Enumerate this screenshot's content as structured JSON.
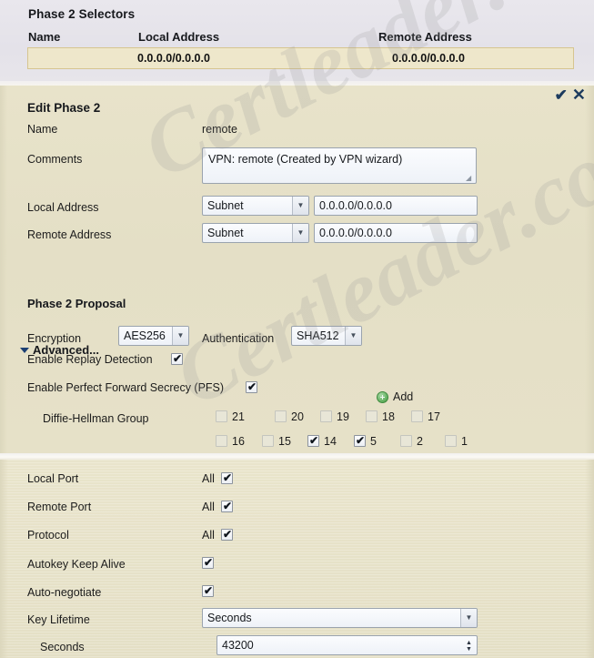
{
  "selectors": {
    "title": "Phase 2 Selectors",
    "columns": [
      "Name",
      "Local Address",
      "Remote Address"
    ],
    "rows": [
      {
        "name": "",
        "local_address": "0.0.0.0/0.0.0.0",
        "remote_address": "0.0.0.0/0.0.0.0"
      }
    ]
  },
  "dialog": {
    "title": "Edit Phase 2",
    "ok_icon": "✔",
    "cancel_icon": "✕",
    "fields": {
      "name_label": "Name",
      "name_value": "remote",
      "comments_label": "Comments",
      "comments_value": "VPN: remote (Created by VPN wizard)",
      "local_address_label": "Local Address",
      "local_address_type": "Subnet",
      "local_address_value": "0.0.0.0/0.0.0.0",
      "remote_address_label": "Remote Address",
      "remote_address_type": "Subnet",
      "remote_address_value": "0.0.0.0/0.0.0.0"
    },
    "advanced_label": "Advanced..."
  },
  "proposal": {
    "title": "Phase 2 Proposal",
    "add_label": "Add",
    "encryption_label": "Encryption",
    "encryption_value": "AES256",
    "authentication_label": "Authentication",
    "authentication_value": "SHA512",
    "replay_label": "Enable Replay Detection",
    "replay_checked": true,
    "pfs_label": "Enable Perfect Forward Secrecy (PFS)",
    "pfs_checked": true,
    "dh_label": "Diffie-Hellman Group",
    "dh_groups_row1": [
      {
        "label": "21",
        "checked": false
      },
      {
        "label": "20",
        "checked": false
      },
      {
        "label": "19",
        "checked": false
      },
      {
        "label": "18",
        "checked": false
      },
      {
        "label": "17",
        "checked": false
      }
    ],
    "dh_groups_row2": [
      {
        "label": "16",
        "checked": false
      },
      {
        "label": "15",
        "checked": false
      },
      {
        "label": "14",
        "checked": true
      },
      {
        "label": "5",
        "checked": true
      },
      {
        "label": "2",
        "checked": false
      },
      {
        "label": "1",
        "checked": false
      }
    ]
  },
  "lower": {
    "local_port_label": "Local Port",
    "local_port_all": "All",
    "local_port_checked": true,
    "remote_port_label": "Remote Port",
    "remote_port_all": "All",
    "remote_port_checked": true,
    "protocol_label": "Protocol",
    "protocol_all": "All",
    "protocol_checked": true,
    "autokey_label": "Autokey Keep Alive",
    "autokey_checked": true,
    "autonegotiate_label": "Auto-negotiate",
    "autonegotiate_checked": true,
    "key_lifetime_label": "Key Lifetime",
    "key_lifetime_value": "Seconds",
    "seconds_label": "Seconds",
    "seconds_value": "43200"
  },
  "watermark": {
    "text": "Certleader.com"
  },
  "colors": {
    "selectors_bg": "#e6e4ea",
    "panel_bg": "#e5e0c7",
    "row_highlight": "#eee7cb",
    "accent_blue": "#1c3b5e",
    "add_green": "#5fae5d"
  }
}
